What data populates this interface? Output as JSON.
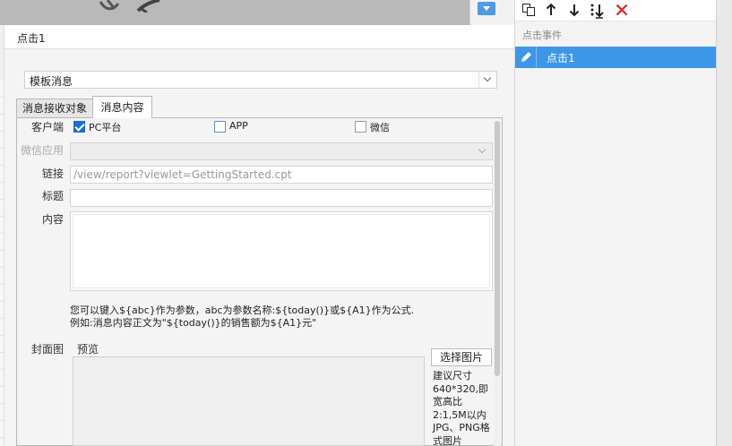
{
  "dialog": {
    "title": "点击1",
    "template_select": {
      "value": "模板消息"
    },
    "tabs": [
      {
        "label": "消息接收对象",
        "active": false
      },
      {
        "label": "消息内容",
        "active": true
      }
    ],
    "form": {
      "client_label": "客户端",
      "clients": [
        {
          "label": "PC平台",
          "checked": true
        },
        {
          "label": "APP",
          "checked": false
        },
        {
          "label": "微信",
          "checked": false
        }
      ],
      "wechat_app_label": "微信应用",
      "link_label": "链接",
      "link_placeholder": "/view/report?viewlet=GettingStarted.cpt",
      "title_label": "标题",
      "content_label": "内容",
      "hint_line1": "您可以键入${abc}作为参数，abc为参数名称:${today()}或${A1}作为公式.",
      "hint_line2": "例如:消息内容正文为\"${today()}的销售额为${A1}元\"",
      "cover_label": "封面图",
      "preview_label": "预览",
      "choose_image_button": "选择图片",
      "size_note": "建议尺寸640*320,即宽高比2:1,5M以内JPG、PNG格式图片"
    }
  },
  "right_panel": {
    "toolbar_icons": [
      "copy-icon",
      "arrow-up-icon",
      "arrow-down-icon",
      "move-bottom-icon",
      "delete-icon"
    ],
    "section_title": "点击事件",
    "events": [
      {
        "label": "点击1",
        "selected": true
      }
    ]
  },
  "colors": {
    "accent": "#3c97e8",
    "checkbox": "#1e6fd9",
    "delete": "#e02020"
  }
}
